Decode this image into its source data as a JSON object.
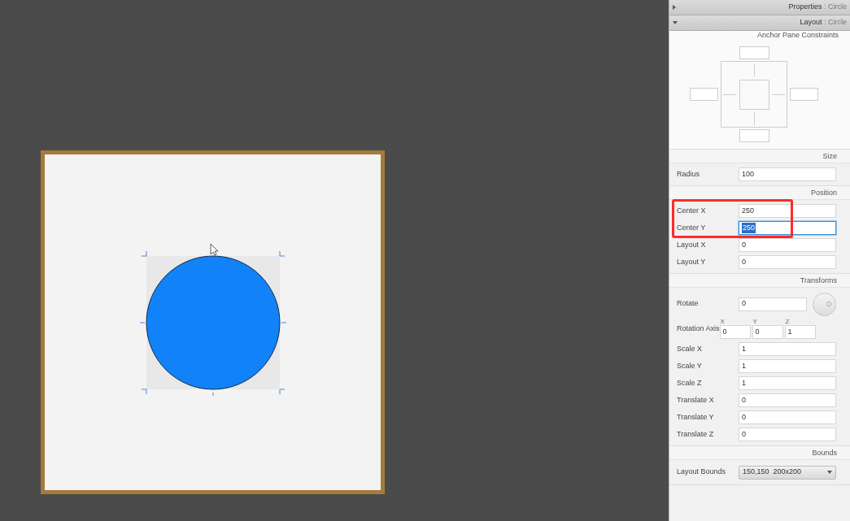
{
  "sections": [
    {
      "label": "Properties",
      "target": ": Circle",
      "expanded": false
    },
    {
      "label": "Layout",
      "target": ": Circle",
      "expanded": true
    }
  ],
  "anchor": {
    "title": "Anchor Pane Constraints"
  },
  "groups": [
    {
      "title": "Size",
      "rows": [
        {
          "kind": "text",
          "label": "Radius",
          "value": "100",
          "focused": false,
          "boxed": false
        }
      ]
    },
    {
      "title": "Position",
      "rows": [
        {
          "kind": "text",
          "label": "Center X",
          "value": "250",
          "focused": false,
          "boxed": true
        },
        {
          "kind": "text",
          "label": "Center Y",
          "value": "250",
          "focused": true,
          "boxed": true
        },
        {
          "kind": "text",
          "label": "Layout X",
          "value": "0",
          "focused": false,
          "boxed": false
        },
        {
          "kind": "text",
          "label": "Layout Y",
          "value": "0",
          "focused": false,
          "boxed": false
        }
      ]
    },
    {
      "title": "Transforms",
      "rows": [
        {
          "kind": "dial",
          "label": "Rotate",
          "value": "0",
          "focused": false,
          "boxed": false
        },
        {
          "kind": "axis",
          "label": "Rotation Axis",
          "axes": [
            {
              "name": "X",
              "value": "0"
            },
            {
              "name": "Y",
              "value": "0"
            },
            {
              "name": "Z",
              "value": "1"
            }
          ],
          "boxed": false
        },
        {
          "kind": "text",
          "label": "Scale X",
          "value": "1",
          "focused": false,
          "boxed": false
        },
        {
          "kind": "text",
          "label": "Scale Y",
          "value": "1",
          "focused": false,
          "boxed": false
        },
        {
          "kind": "text",
          "label": "Scale Z",
          "value": "1",
          "focused": false,
          "boxed": false
        },
        {
          "kind": "text",
          "label": "Translate X",
          "value": "0",
          "focused": false,
          "boxed": false
        },
        {
          "kind": "text",
          "label": "Translate Y",
          "value": "0",
          "focused": false,
          "boxed": false
        },
        {
          "kind": "text",
          "label": "Translate Z",
          "value": "0",
          "focused": false,
          "boxed": false
        }
      ]
    },
    {
      "title": "Bounds",
      "rows": [
        {
          "kind": "select",
          "label": "Layout Bounds",
          "value": "150,150  200x200",
          "boxed": false
        }
      ]
    }
  ]
}
